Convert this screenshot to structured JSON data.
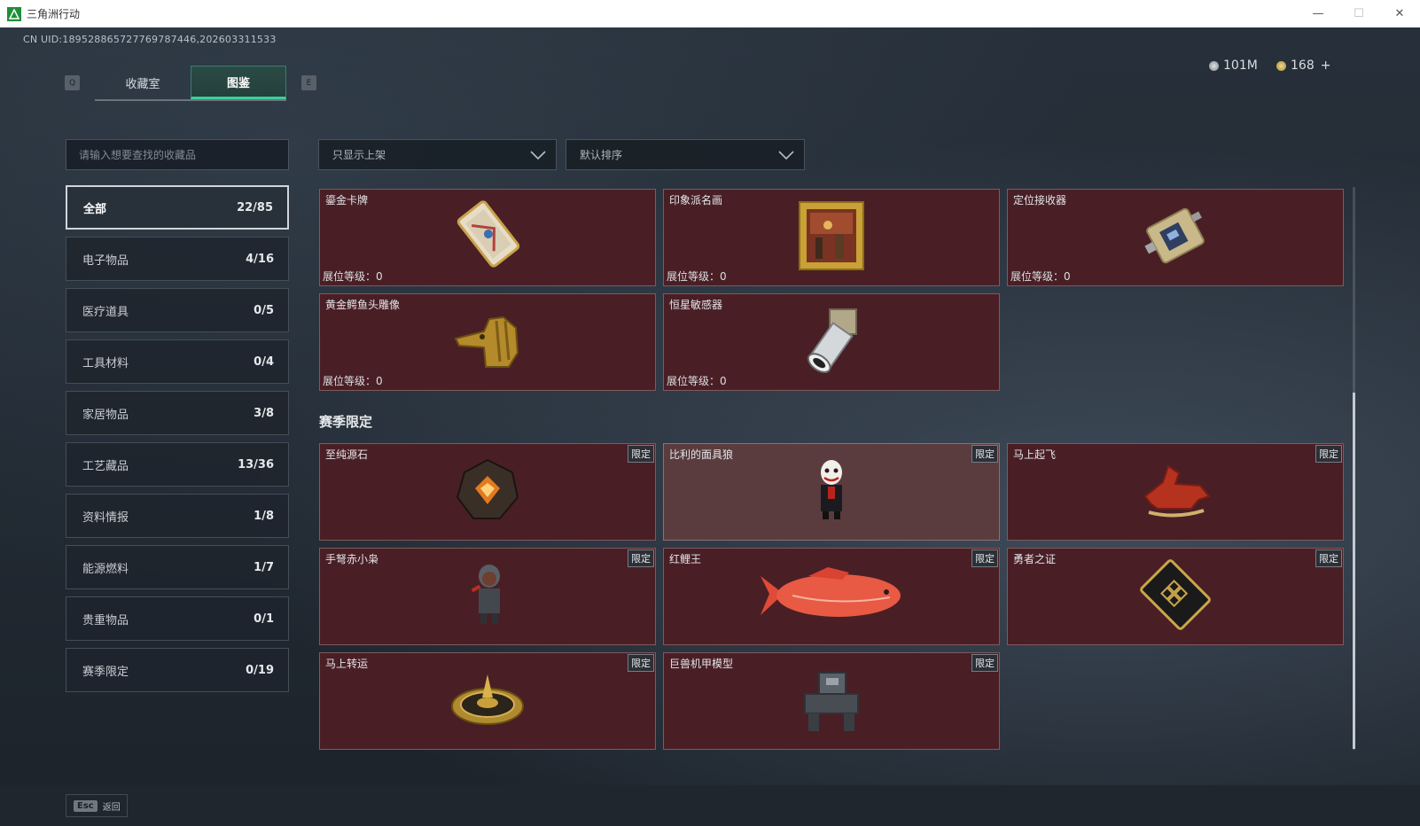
{
  "window": {
    "title": "三角洲行动",
    "controls": [
      "—",
      "☐",
      "✕"
    ]
  },
  "uid": "CN UID:18952886572776978744​6,202603311533",
  "currency": {
    "money": "101M",
    "coins": "168",
    "add": "+"
  },
  "keys": {
    "prev": "Q",
    "next": "E"
  },
  "tabs": [
    {
      "label": "收藏室"
    },
    {
      "label": "图鉴"
    }
  ],
  "search": {
    "placeholder": "请输入想要查找的收藏品"
  },
  "categories": [
    {
      "label": "全部",
      "count": "22/85"
    },
    {
      "label": "电子物品",
      "count": "4/16"
    },
    {
      "label": "医疗道具",
      "count": "0/5"
    },
    {
      "label": "工具材料",
      "count": "0/4"
    },
    {
      "label": "家居物品",
      "count": "3/8"
    },
    {
      "label": "工艺藏品",
      "count": "13/36"
    },
    {
      "label": "资料情报",
      "count": "1/8"
    },
    {
      "label": "能源燃料",
      "count": "1/7"
    },
    {
      "label": "贵重物品",
      "count": "0/1"
    },
    {
      "label": "赛季限定",
      "count": "0/19"
    }
  ],
  "filters": {
    "show": "只显示上架",
    "sort": "默认排序"
  },
  "level_label": "展位等级：",
  "level_value": "0",
  "limited_label": "限定",
  "items": [
    {
      "name": "鎏金卡牌"
    },
    {
      "name": "印象派名画"
    },
    {
      "name": "定位接收器"
    },
    {
      "name": "黄金鳄鱼头雕像"
    },
    {
      "name": "恒星敏感器"
    }
  ],
  "season_title": "赛季限定",
  "season_items": [
    {
      "name": "至纯源石"
    },
    {
      "name": "比利的面具狼"
    },
    {
      "name": "马上起飞"
    },
    {
      "name": "手弩赤小枭"
    },
    {
      "name": "红鲤王"
    },
    {
      "name": "勇者之证"
    },
    {
      "name": "马上转运"
    },
    {
      "name": "巨兽机甲模型"
    }
  ],
  "footer": {
    "key": "Esc",
    "label": "返回"
  },
  "colors": {
    "card_bg": "#491f25",
    "accent": "#3ecf9a"
  }
}
